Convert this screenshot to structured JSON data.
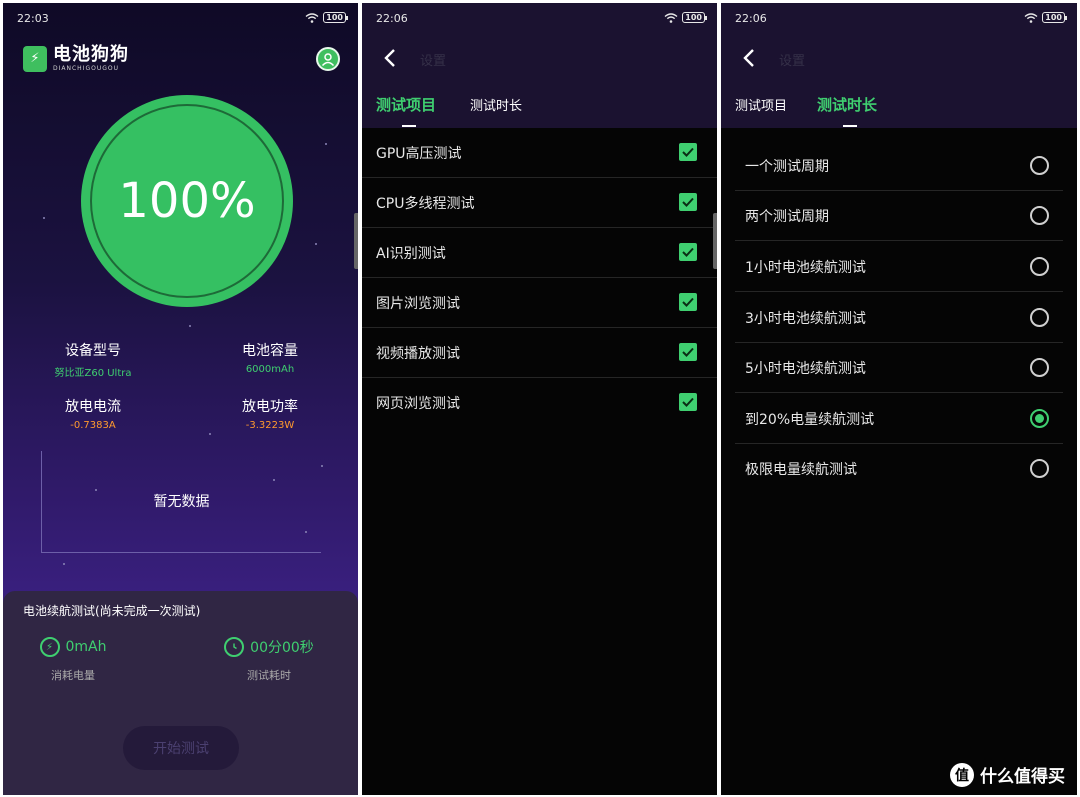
{
  "colors": {
    "accent_green": "#3fcf70",
    "warning_orange": "#ff9a2e",
    "header_bg": "#1b1230",
    "list_bg": "#050505"
  },
  "panel1": {
    "time": "22:03",
    "battery": "100",
    "app_name": "电池狗狗",
    "app_name_en": "DIANCHIGOUGOU",
    "battery_percent": "100%",
    "device_label": "设备型号",
    "device_value": "努比亚Z60 Ultra",
    "capacity_label": "电池容量",
    "capacity_value": "6000mAh",
    "current_label": "放电电流",
    "current_value": "-0.7383A",
    "power_label": "放电功率",
    "power_value": "-3.3223W",
    "chart_empty": "暂无数据",
    "card_title": "电池续航测试(尚未完成一次测试)",
    "consumed_value": "0mAh",
    "consumed_label": "消耗电量",
    "elapsed_value": "00分00秒",
    "elapsed_label": "测试耗时",
    "start_button": "开始测试"
  },
  "panel2": {
    "time": "22:06",
    "battery": "100",
    "title": "设置",
    "tab_items": "测试项目",
    "tab_duration": "测试时长",
    "items": [
      {
        "label": "GPU高压测试",
        "checked": true
      },
      {
        "label": "CPU多线程测试",
        "checked": true
      },
      {
        "label": "AI识别测试",
        "checked": true
      },
      {
        "label": "图片浏览测试",
        "checked": true
      },
      {
        "label": "视频播放测试",
        "checked": true
      },
      {
        "label": "网页浏览测试",
        "checked": true
      }
    ]
  },
  "panel3": {
    "time": "22:06",
    "battery": "100",
    "title": "设置",
    "tab_items": "测试项目",
    "tab_duration": "测试时长",
    "options": [
      {
        "label": "一个测试周期",
        "selected": false
      },
      {
        "label": "两个测试周期",
        "selected": false
      },
      {
        "label": "1小时电池续航测试",
        "selected": false
      },
      {
        "label": "3小时电池续航测试",
        "selected": false
      },
      {
        "label": "5小时电池续航测试",
        "selected": false
      },
      {
        "label": "到20%电量续航测试",
        "selected": true
      },
      {
        "label": "极限电量续航测试",
        "selected": false
      }
    ]
  },
  "watermark": {
    "badge": "值",
    "text": "什么值得买"
  }
}
